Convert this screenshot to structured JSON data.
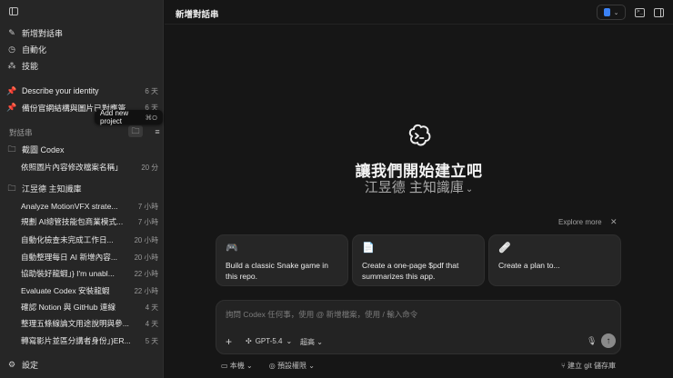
{
  "sidebar": {
    "nav": [
      {
        "label": "新增對話串",
        "icon": "edit-icon"
      },
      {
        "label": "自動化",
        "icon": "clock-icon"
      },
      {
        "label": "技能",
        "icon": "skills-icon"
      }
    ],
    "pinned": [
      {
        "label": "Describe your identity",
        "time": "6 天"
      },
      {
        "label": "備份官網結構與圖片已對應簽",
        "time": "6 天"
      }
    ],
    "section_label": "對話串",
    "tooltip": {
      "text": "Add new project",
      "shortcut": "⌘O"
    },
    "folders": [
      {
        "name": "截圖 Codex",
        "threads": [
          {
            "label": "依照圖片內容修改檔案名稱」",
            "time": "20 分"
          }
        ]
      },
      {
        "name": "江昱德 主知識庫",
        "threads": [
          {
            "label": "Analyze MotionVFX strate...",
            "time": "7 小時"
          },
          {
            "label": "規劃 AI總管技能包商業模式...",
            "time": "7 小時"
          },
          {
            "label": "自動化檢查未完成工作日...",
            "time": "20 小時"
          },
          {
            "label": "自動整理每日 AI 新增內容...",
            "time": "20 小時"
          },
          {
            "label": "協助裝好龍蝦」} I'm unabl...",
            "time": "22 小時"
          },
          {
            "label": "Evaluate Codex 安裝龍蝦",
            "time": "22 小時"
          },
          {
            "label": "確認 Notion 與 GitHub 連線",
            "time": "4 天"
          },
          {
            "label": "整理五條線論文用途說明與參...",
            "time": "4 天"
          },
          {
            "label": "轉寫影片並區分講者身份」}ER...",
            "time": "5 天"
          }
        ]
      }
    ],
    "settings_label": "設定"
  },
  "main": {
    "title": "新增對話串",
    "hero_title": "讓我們開始建立吧",
    "hero_sub": "江昱德 主知識庫",
    "explore_label": "Explore more",
    "cards": [
      {
        "icon": "🎮",
        "text": "Build a classic Snake game in this repo."
      },
      {
        "icon": "📄",
        "text": "Create a one-page $pdf that summarizes this app."
      },
      {
        "icon": "🩹",
        "text": "Create a plan to..."
      }
    ],
    "composer": {
      "placeholder": "詢問 Codex 任何事，使用 @ 新增檔案，使用 / 輸入命令",
      "model": "GPT-5.4",
      "effort": "超高"
    },
    "bottom": {
      "local": "本機",
      "permissions": "預設權限",
      "branch": "建立 git 儲存庫"
    }
  },
  "colors": {
    "accent_arrow": "#f08a1c",
    "send": "#8a8a8a"
  }
}
